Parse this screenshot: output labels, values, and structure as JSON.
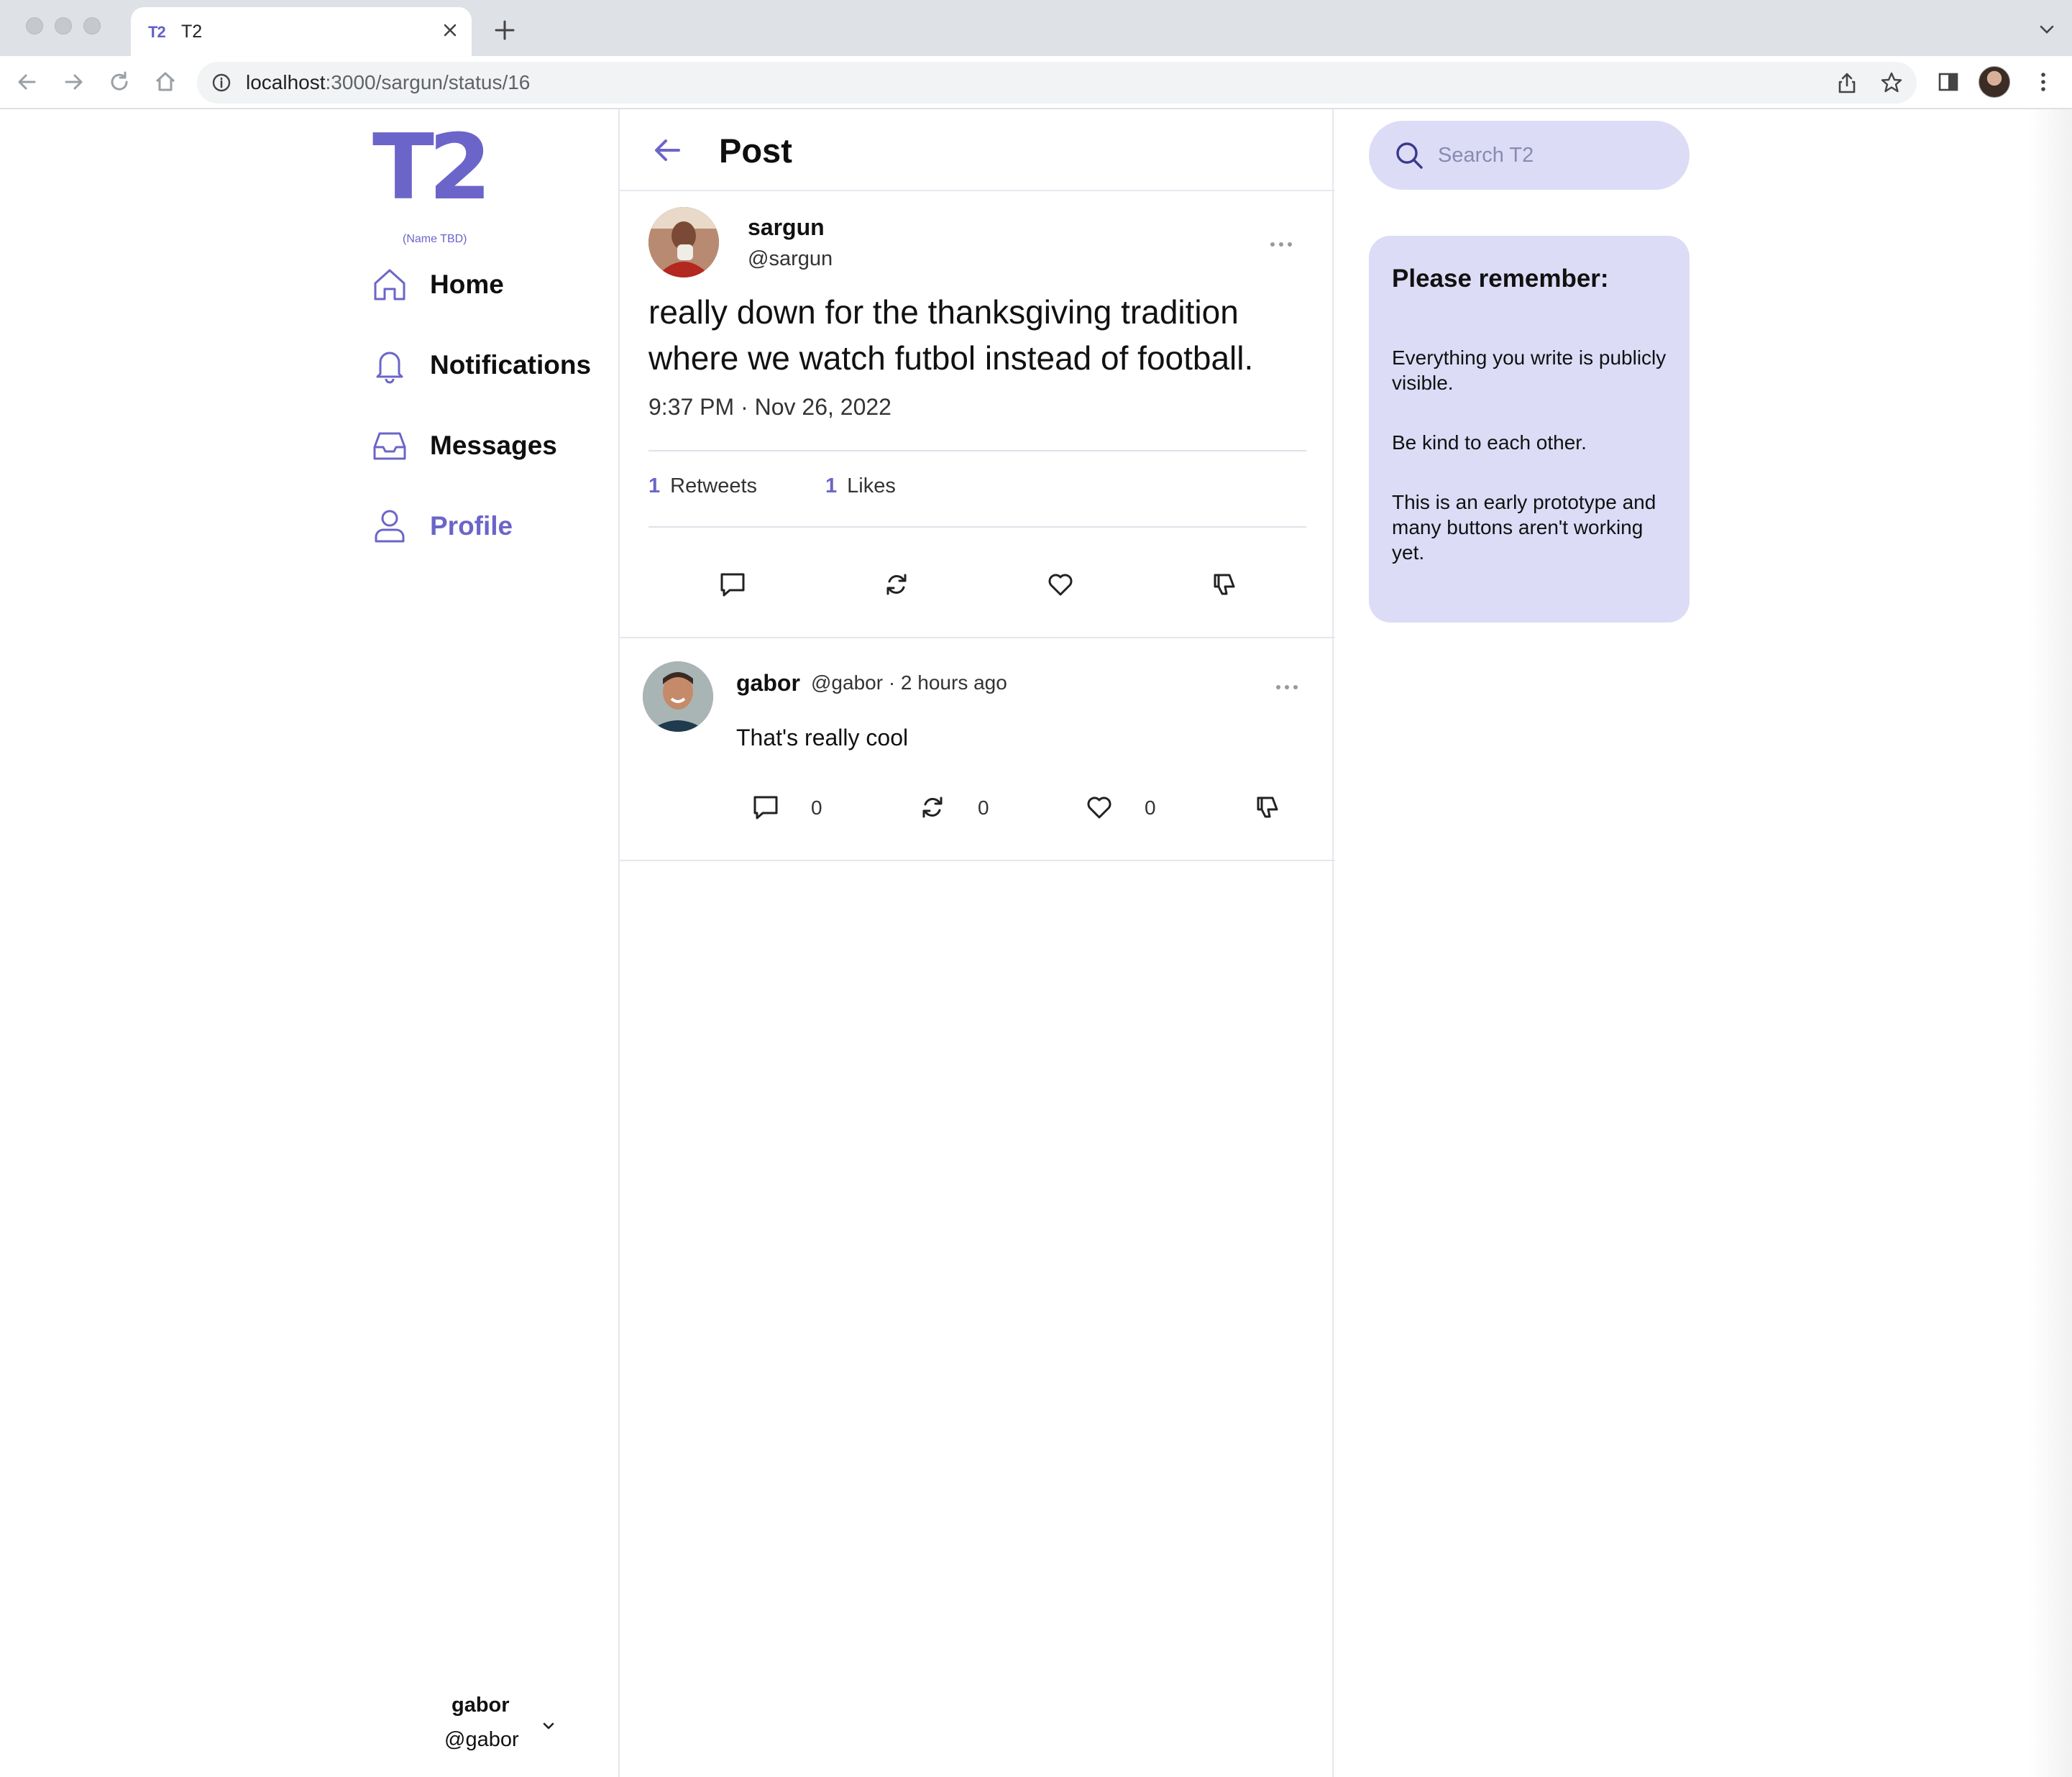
{
  "browser": {
    "tab_title": "T2",
    "tab_favicon": "T2",
    "url_host": "localhost",
    "url_rest": ":3000/sargun/status/16"
  },
  "sidebar": {
    "logo": "T2",
    "logo_sub": "(Name TBD)",
    "items": [
      {
        "label": "Home",
        "icon": "home-icon"
      },
      {
        "label": "Notifications",
        "icon": "bell-icon"
      },
      {
        "label": "Messages",
        "icon": "inbox-icon"
      },
      {
        "label": "Profile",
        "icon": "user-icon",
        "active": true
      }
    ],
    "current_user": {
      "name": "gabor",
      "handle": "@gabor"
    }
  },
  "main": {
    "header_title": "Post",
    "post": {
      "author_name": "sargun",
      "author_handle": "@sargun",
      "body": "really down for the thanksgiving tradition where we watch futbol instead of football.",
      "time": "9:37 PM · Nov 26, 2022",
      "retweets_count": "1",
      "retweets_label": "Retweets",
      "likes_count": "1",
      "likes_label": "Likes"
    },
    "reply": {
      "author_name": "gabor",
      "meta": "@gabor ·  2 hours ago",
      "body": "That's really cool",
      "comments": "0",
      "retweets": "0",
      "likes": "0"
    }
  },
  "right": {
    "search_placeholder": "Search T2",
    "remember_title": "Please remember:",
    "remember_items": [
      "Everything you write is publicly visible.",
      "Be kind to each other.",
      "This is an early prototype and many buttons aren't working yet."
    ]
  },
  "colors": {
    "accent": "#6b65c9",
    "panel": "#dcdcf7"
  }
}
